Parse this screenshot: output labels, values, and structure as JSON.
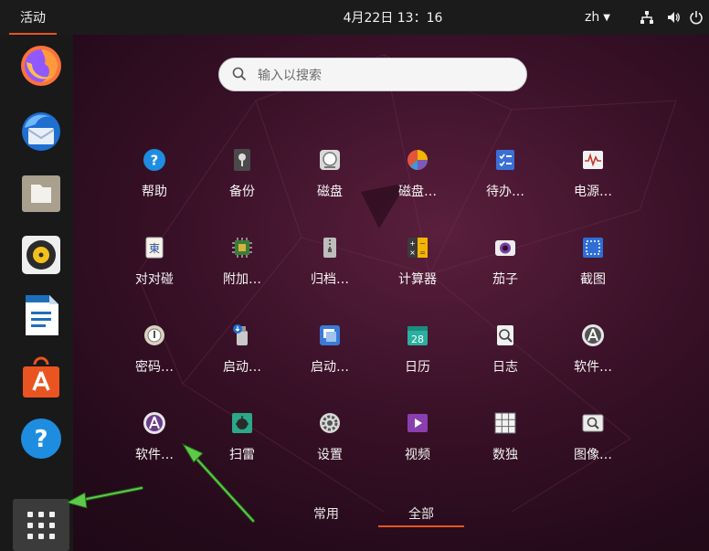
{
  "topbar": {
    "activities": "活动",
    "clock": "4月22日  13：16",
    "input_method": "zh",
    "tray_icons": [
      "network-icon",
      "volume-icon",
      "power-icon"
    ]
  },
  "dock": {
    "items": [
      "firefox-icon",
      "thunderbird-icon",
      "files-icon",
      "rhythmbox-icon",
      "writer-icon",
      "software-icon",
      "help-icon"
    ],
    "show_apps": "show-applications-icon"
  },
  "search": {
    "placeholder": "输入以搜索"
  },
  "apps": [
    "帮助",
    "备份",
    "磁盘",
    "磁盘…",
    "待办…",
    "电源…",
    "对对碰",
    "附加…",
    "归档…",
    "计算器",
    "茄子",
    "截图",
    "密码…",
    "启动…",
    "启动…",
    "日历",
    "日志",
    "软件…",
    "软件…",
    "扫雷",
    "设置",
    "视频",
    "数独",
    "图像…"
  ],
  "calendar_day": "28",
  "tabs": {
    "frequent": "常用",
    "all": "全部"
  },
  "colors": {
    "accent": "#e95420",
    "arrow": "#3c9a2a"
  }
}
